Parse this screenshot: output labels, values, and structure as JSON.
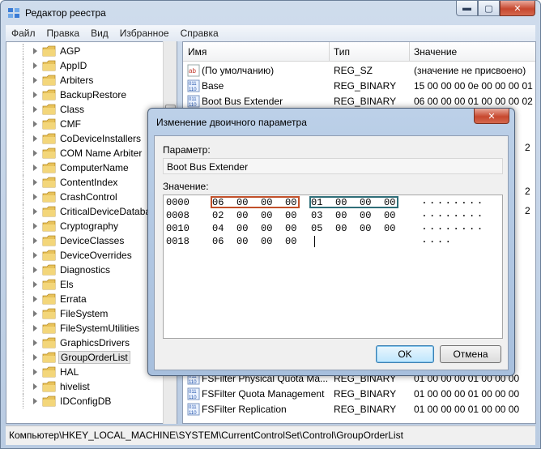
{
  "window": {
    "title": "Редактор реестра",
    "buttons": {
      "minimize": "▬",
      "maximize": "▢",
      "close": "✕"
    }
  },
  "menu": [
    "Файл",
    "Правка",
    "Вид",
    "Избранное",
    "Справка"
  ],
  "tree": {
    "items": [
      "AGP",
      "AppID",
      "Arbiters",
      "BackupRestore",
      "Class",
      "CMF",
      "CoDeviceInstallers",
      "COM Name Arbiter",
      "ComputerName",
      "ContentIndex",
      "CrashControl",
      "CriticalDeviceDataba",
      "Cryptography",
      "DeviceClasses",
      "DeviceOverrides",
      "Diagnostics",
      "Els",
      "Errata",
      "FileSystem",
      "FileSystemUtilities",
      "GraphicsDrivers",
      "GroupOrderList",
      "HAL",
      "hivelist",
      "IDConfigDB"
    ],
    "selected": "GroupOrderList"
  },
  "list": {
    "headers": {
      "name": "Имя",
      "type": "Тип",
      "value": "Значение"
    },
    "rows_top": [
      {
        "icon": "string-value-icon",
        "name": "(По умолчанию)",
        "type": "REG_SZ",
        "value": "(значение не присвоено)"
      },
      {
        "icon": "binary-value-icon",
        "name": "Base",
        "type": "REG_BINARY",
        "value": "15 00 00 00 0e 00 00 00 01"
      },
      {
        "icon": "binary-value-icon",
        "name": "Boot Bus Extender",
        "type": "REG_BINARY",
        "value": "06 00 00 00 01 00 00 00 02"
      }
    ],
    "rows_bottom": [
      {
        "icon": "binary-value-icon",
        "name": "FSFilter Physical Quota Ma...",
        "type": "REG_BINARY",
        "value": "01 00 00 00 01 00 00 00"
      },
      {
        "icon": "binary-value-icon",
        "name": "FSFilter Quota Management",
        "type": "REG_BINARY",
        "value": "01 00 00 00 01 00 00 00"
      },
      {
        "icon": "binary-value-icon",
        "name": "FSFilter Replication",
        "type": "REG_BINARY",
        "value": "01 00 00 00 01 00 00 00"
      }
    ],
    "right_edge_digits": [
      "2",
      "2",
      "2"
    ]
  },
  "status": "Компьютер\\HKEY_LOCAL_MACHINE\\SYSTEM\\CurrentControlSet\\Control\\GroupOrderList",
  "dialog": {
    "title": "Изменение двоичного параметра",
    "close": "✕",
    "param_label": "Параметр:",
    "param_value": "Boot Bus Extender",
    "value_label": "Значение:",
    "hex": [
      {
        "addr": "0000",
        "bytes": [
          "06",
          "00",
          "00",
          "00",
          "01",
          "00",
          "00",
          "00"
        ],
        "ascii": "........"
      },
      {
        "addr": "0008",
        "bytes": [
          "02",
          "00",
          "00",
          "00",
          "03",
          "00",
          "00",
          "00"
        ],
        "ascii": "........"
      },
      {
        "addr": "0010",
        "bytes": [
          "04",
          "00",
          "00",
          "00",
          "05",
          "00",
          "00",
          "00"
        ],
        "ascii": "........"
      },
      {
        "addr": "0018",
        "bytes": [
          "06",
          "00",
          "00",
          "00"
        ],
        "ascii": "...."
      }
    ],
    "ok": "OK",
    "cancel": "Отмена"
  },
  "colors": {
    "highlight_red": "#c1502a",
    "highlight_teal": "#2f6e78"
  }
}
